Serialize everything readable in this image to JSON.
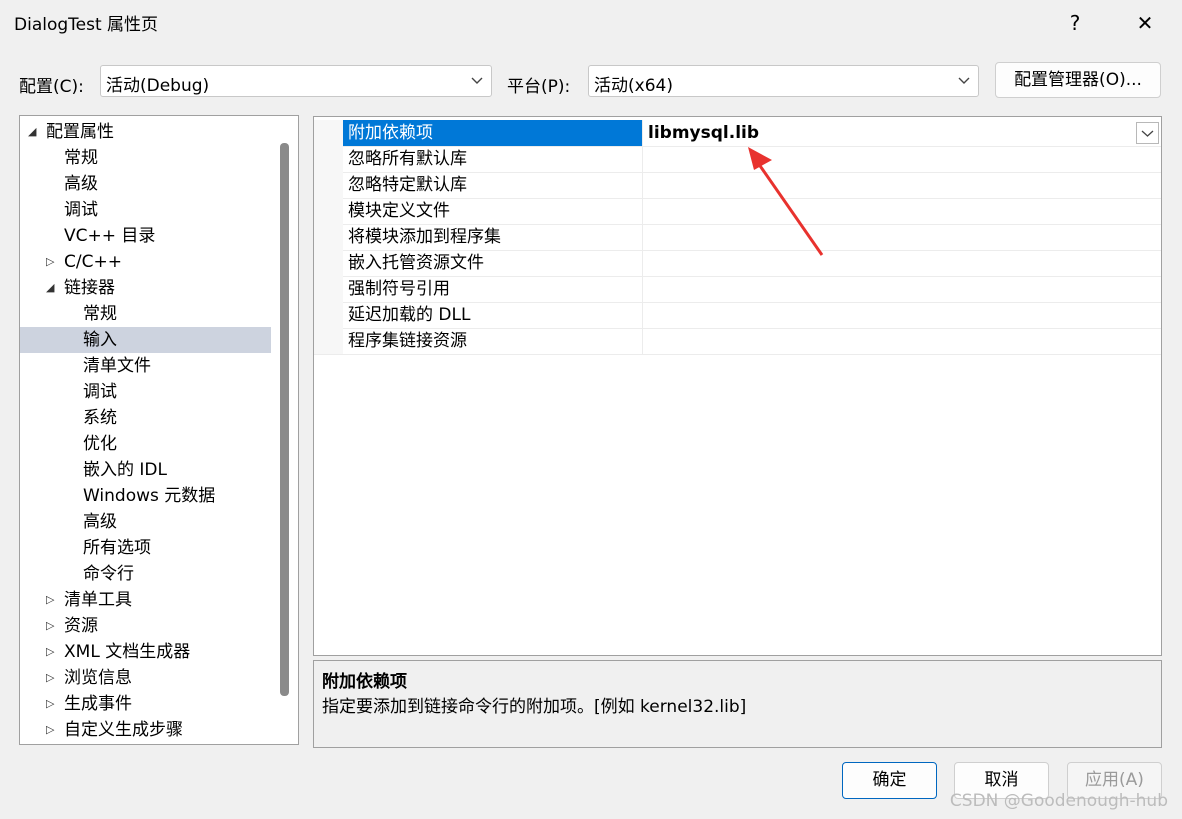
{
  "window": {
    "title": "DialogTest 属性页",
    "help_label": "?",
    "close_label": "✕"
  },
  "toolbar": {
    "config_label": "配置(C):",
    "config_value": "活动(Debug)",
    "platform_label": "平台(P):",
    "platform_value": "活动(x64)",
    "config_manager_label": "配置管理器(O)..."
  },
  "tree": {
    "items": [
      {
        "label": "配置属性",
        "level": 0,
        "expander": "open",
        "selected": false
      },
      {
        "label": "常规",
        "level": 1,
        "expander": "none",
        "selected": false
      },
      {
        "label": "高级",
        "level": 1,
        "expander": "none",
        "selected": false
      },
      {
        "label": "调试",
        "level": 1,
        "expander": "none",
        "selected": false
      },
      {
        "label": "VC++ 目录",
        "level": 1,
        "expander": "none",
        "selected": false
      },
      {
        "label": "C/C++",
        "level": 1,
        "expander": "closed",
        "selected": false
      },
      {
        "label": "链接器",
        "level": 1,
        "expander": "open",
        "selected": false
      },
      {
        "label": "常规",
        "level": 2,
        "expander": "none",
        "selected": false
      },
      {
        "label": "输入",
        "level": 2,
        "expander": "none",
        "selected": true
      },
      {
        "label": "清单文件",
        "level": 2,
        "expander": "none",
        "selected": false
      },
      {
        "label": "调试",
        "level": 2,
        "expander": "none",
        "selected": false
      },
      {
        "label": "系统",
        "level": 2,
        "expander": "none",
        "selected": false
      },
      {
        "label": "优化",
        "level": 2,
        "expander": "none",
        "selected": false
      },
      {
        "label": "嵌入的 IDL",
        "level": 2,
        "expander": "none",
        "selected": false
      },
      {
        "label": "Windows 元数据",
        "level": 2,
        "expander": "none",
        "selected": false
      },
      {
        "label": "高级",
        "level": 2,
        "expander": "none",
        "selected": false
      },
      {
        "label": "所有选项",
        "level": 2,
        "expander": "none",
        "selected": false
      },
      {
        "label": "命令行",
        "level": 2,
        "expander": "none",
        "selected": false
      },
      {
        "label": "清单工具",
        "level": 1,
        "expander": "closed",
        "selected": false
      },
      {
        "label": "资源",
        "level": 1,
        "expander": "closed",
        "selected": false
      },
      {
        "label": "XML 文档生成器",
        "level": 1,
        "expander": "closed",
        "selected": false
      },
      {
        "label": "浏览信息",
        "level": 1,
        "expander": "closed",
        "selected": false
      },
      {
        "label": "生成事件",
        "level": 1,
        "expander": "closed",
        "selected": false
      },
      {
        "label": "自定义生成步骤",
        "level": 1,
        "expander": "closed",
        "selected": false
      }
    ]
  },
  "properties": {
    "rows": [
      {
        "name": "附加依赖项",
        "value": "libmysql.lib",
        "selected": true
      },
      {
        "name": "忽略所有默认库",
        "value": "",
        "selected": false
      },
      {
        "name": "忽略特定默认库",
        "value": "",
        "selected": false
      },
      {
        "name": "模块定义文件",
        "value": "",
        "selected": false
      },
      {
        "name": "将模块添加到程序集",
        "value": "",
        "selected": false
      },
      {
        "name": "嵌入托管资源文件",
        "value": "",
        "selected": false
      },
      {
        "name": "强制符号引用",
        "value": "",
        "selected": false
      },
      {
        "name": "延迟加载的 DLL",
        "value": "",
        "selected": false
      },
      {
        "name": "程序集链接资源",
        "value": "",
        "selected": false
      }
    ]
  },
  "description": {
    "heading": "附加依赖项",
    "text": "指定要添加到链接命令行的附加项。[例如 kernel32.lib]"
  },
  "buttons": {
    "ok": "确定",
    "cancel": "取消",
    "apply": "应用(A)"
  },
  "watermark": "CSDN @Goodenough-hub",
  "colors": {
    "selection_blue": "#0078d7",
    "tree_selection": "#cdd3df",
    "annotation_arrow": "#e8322e"
  },
  "icons": {
    "dropdown": "chevron-down-icon",
    "expand_open": "triangle-down-icon",
    "expand_closed": "triangle-right-icon"
  }
}
